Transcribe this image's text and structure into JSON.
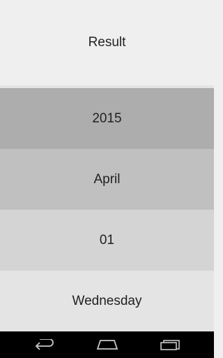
{
  "result": {
    "title": "Result"
  },
  "rows": {
    "year": "2015",
    "month": "April",
    "day": "01",
    "weekday": "Wednesday"
  },
  "navbar": {
    "buttons": [
      "back-icon",
      "home-icon",
      "recent-apps-icon"
    ]
  },
  "colors": {
    "header_bg": "#efefef",
    "year_bg": "#aeadae",
    "month_bg": "#c1c0c1",
    "day_bg": "#d4d4d4",
    "weekday_bg": "#e4e4e4",
    "navbar_bg": "#000000",
    "text": "#222222"
  }
}
